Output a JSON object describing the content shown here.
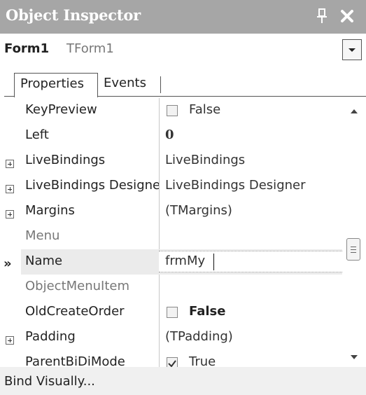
{
  "window": {
    "title": "Object Inspector",
    "title_bar_color": "#a6a6a6"
  },
  "selector": {
    "object_name": "Form1",
    "object_type": "TForm1"
  },
  "tabs": [
    {
      "label": "Properties",
      "active": true
    },
    {
      "label": "Events",
      "active": false
    }
  ],
  "properties": [
    {
      "name": "KeyPreview",
      "value": "False",
      "checkbox": true
    },
    {
      "name": "Left",
      "value": "0"
    },
    {
      "name": "LiveBindings",
      "value": "LiveBindings",
      "expandable": true
    },
    {
      "name": "LiveBindings Designer",
      "value": "LiveBindings Designer",
      "expandable": true
    },
    {
      "name": "Margins",
      "value": "(TMargins)",
      "expandable": true
    },
    {
      "name": "Menu",
      "value": ""
    },
    {
      "name": "Name",
      "value": "frmMy",
      "selected": true,
      "marker": "»"
    },
    {
      "name": "ObjectMenuItem",
      "value": ""
    },
    {
      "name": "OldCreateOrder",
      "value": "False",
      "checkbox": true
    },
    {
      "name": "Padding",
      "value": "(TPadding)",
      "expandable": true
    },
    {
      "name": "ParentBiDiMode",
      "value": "True",
      "checkbox": true,
      "checked": true
    }
  ],
  "status": {
    "label": "Bind Visually..."
  }
}
